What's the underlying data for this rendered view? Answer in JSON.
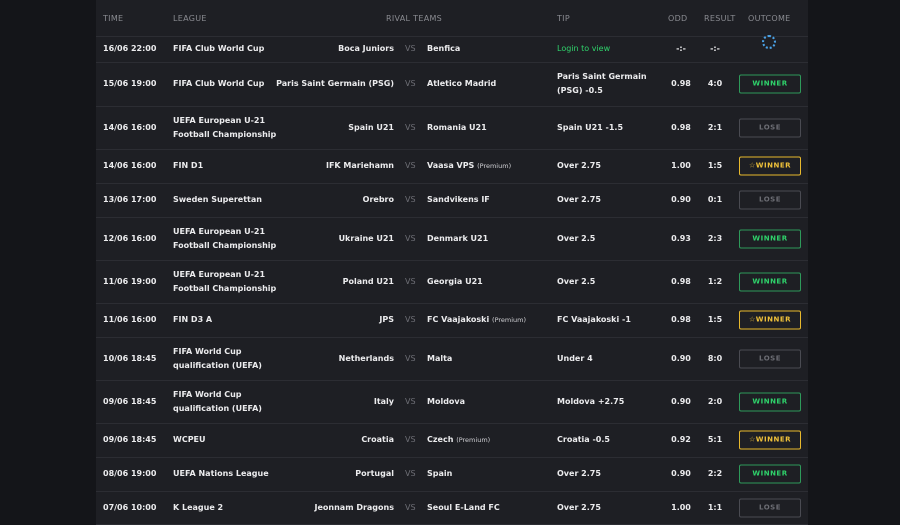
{
  "headers": {
    "time": "TIME",
    "league": "LEAGUE",
    "rival": "RIVAL TEAMS",
    "tip": "TIP",
    "odd": "ODD",
    "result": "RESULT",
    "outcome": "OUTCOME"
  },
  "vs_label": "VS",
  "rows": [
    {
      "time": "16/06 22:00",
      "league": "FIFA Club World Cup",
      "home": "Boca Juniors",
      "away": "Benfica",
      "away_note": "",
      "tip": "Login to view",
      "odd": "-:-",
      "result": "-:-",
      "outcome": "",
      "outcome_type": "pending"
    },
    {
      "time": "15/06 19:00",
      "league": "FIFA Club World Cup",
      "home": "Paris Saint Germain (PSG)",
      "away": "Atletico Madrid",
      "away_note": "",
      "tip": "Paris Saint Germain (PSG) -0.5",
      "odd": "0.98",
      "result": "4:0",
      "outcome": "WINNER",
      "outcome_type": "win"
    },
    {
      "time": "14/06 16:00",
      "league": "UEFA European U-21 Football Championship",
      "home": "Spain U21",
      "away": "Romania U21",
      "away_note": "",
      "tip": "Spain U21 -1.5",
      "odd": "0.98",
      "result": "2:1",
      "outcome": "LOSE",
      "outcome_type": "lose"
    },
    {
      "time": "14/06 16:00",
      "league": "FIN D1",
      "home": "IFK Mariehamn",
      "away": "Vaasa VPS",
      "away_note": "(Premium)",
      "tip": "Over 2.75",
      "odd": "1.00",
      "result": "1:5",
      "outcome": "☆WINNER",
      "outcome_type": "premium"
    },
    {
      "time": "13/06 17:00",
      "league": "Sweden Superettan",
      "home": "Orebro",
      "away": "Sandvikens IF",
      "away_note": "",
      "tip": "Over 2.75",
      "odd": "0.90",
      "result": "0:1",
      "outcome": "LOSE",
      "outcome_type": "lose"
    },
    {
      "time": "12/06 16:00",
      "league": "UEFA European U-21 Football Championship",
      "home": "Ukraine U21",
      "away": "Denmark U21",
      "away_note": "",
      "tip": "Over 2.5",
      "odd": "0.93",
      "result": "2:3",
      "outcome": "WINNER",
      "outcome_type": "win"
    },
    {
      "time": "11/06 19:00",
      "league": "UEFA European U-21 Football Championship",
      "home": "Poland U21",
      "away": "Georgia U21",
      "away_note": "",
      "tip": "Over 2.5",
      "odd": "0.98",
      "result": "1:2",
      "outcome": "WINNER",
      "outcome_type": "win"
    },
    {
      "time": "11/06 16:00",
      "league": "FIN D3 A",
      "home": "JPS",
      "away": "FC Vaajakoski",
      "away_note": "(Premium)",
      "tip": "FC Vaajakoski -1",
      "odd": "0.98",
      "result": "1:5",
      "outcome": "☆WINNER",
      "outcome_type": "premium"
    },
    {
      "time": "10/06 18:45",
      "league": "FIFA World Cup qualification (UEFA)",
      "home": "Netherlands",
      "away": "Malta",
      "away_note": "",
      "tip": "Under 4",
      "odd": "0.90",
      "result": "8:0",
      "outcome": "LOSE",
      "outcome_type": "lose"
    },
    {
      "time": "09/06 18:45",
      "league": "FIFA World Cup qualification (UEFA)",
      "home": "Italy",
      "away": "Moldova",
      "away_note": "",
      "tip": "Moldova +2.75",
      "odd": "0.90",
      "result": "2:0",
      "outcome": "WINNER",
      "outcome_type": "win"
    },
    {
      "time": "09/06 18:45",
      "league": "WCPEU",
      "home": "Croatia",
      "away": "Czech",
      "away_note": "(Premium)",
      "tip": "Croatia -0.5",
      "odd": "0.92",
      "result": "5:1",
      "outcome": "☆WINNER",
      "outcome_type": "premium"
    },
    {
      "time": "08/06 19:00",
      "league": "UEFA Nations League",
      "home": "Portugal",
      "away": "Spain",
      "away_note": "",
      "tip": "Over 2.75",
      "odd": "0.90",
      "result": "2:2",
      "outcome": "WINNER",
      "outcome_type": "win"
    },
    {
      "time": "07/06 10:00",
      "league": "K League 2",
      "home": "Jeonnam Dragons",
      "away": "Seoul E-Land FC",
      "away_note": "",
      "tip": "Over 2.75",
      "odd": "1.00",
      "result": "1:1",
      "outcome": "LOSE",
      "outcome_type": "lose"
    }
  ]
}
